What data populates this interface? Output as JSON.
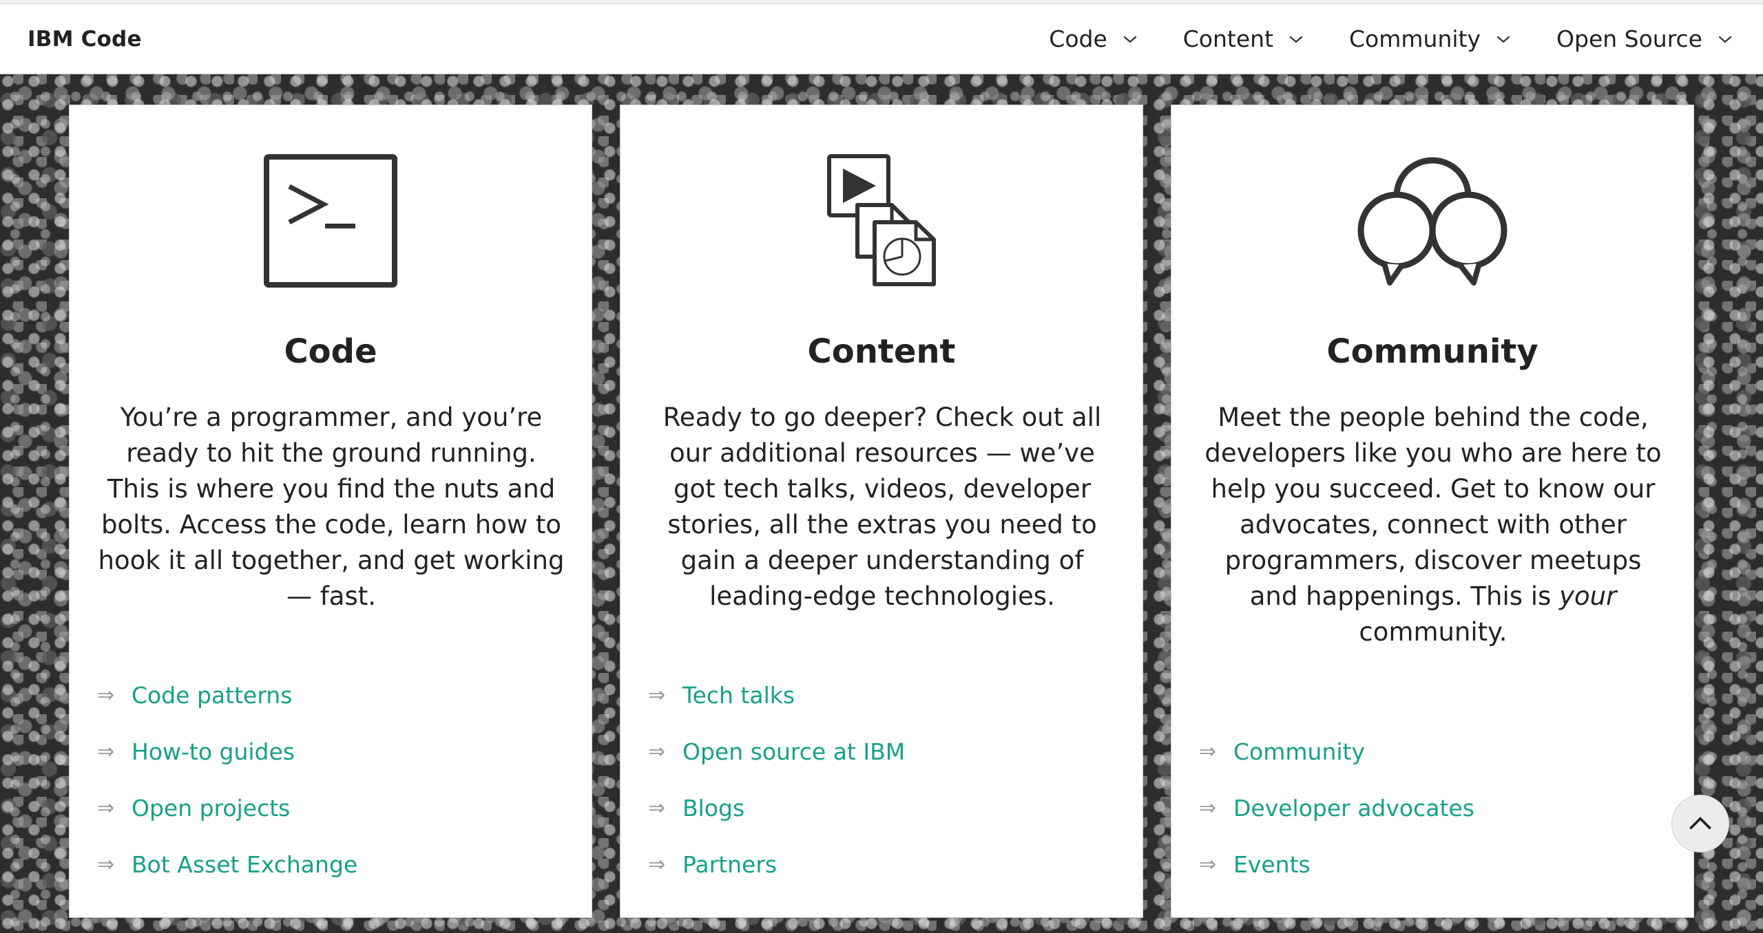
{
  "header": {
    "brand": "IBM Code",
    "nav": [
      {
        "label": "Code",
        "icon": "chevron-down-icon"
      },
      {
        "label": "Content",
        "icon": "chevron-down-icon"
      },
      {
        "label": "Community",
        "icon": "chevron-down-icon"
      },
      {
        "label": "Open Source",
        "icon": "chevron-down-icon"
      }
    ]
  },
  "cards": [
    {
      "icon": "terminal-icon",
      "title": "Code",
      "description": "You’re a programmer, and you’re ready to hit the ground running. This is where you find the nuts and bolts. Access the code, learn how to hook it all together, and get working — fast.",
      "links": [
        "Code patterns",
        "How-to guides",
        "Open projects",
        "Bot Asset Exchange"
      ]
    },
    {
      "icon": "media-documents-icon",
      "title": "Content",
      "description": "Ready to go deeper? Check out all our additional resources — we’ve got tech talks, videos, developer stories, all the extras you need to gain a deeper understanding of leading-edge technologies.",
      "links": [
        "Tech talks",
        "Open source at IBM",
        "Blogs",
        "Partners"
      ]
    },
    {
      "icon": "speech-bubbles-icon",
      "title": "Community",
      "description_before": "Meet the people behind the code, developers like you who are here to help you succeed. Get to know our advocates, connect with other programmers, discover meetups and happenings. This is ",
      "description_em": "your",
      "description_after": " community.",
      "links": [
        "Community",
        "Developer advocates",
        "Events"
      ]
    }
  ],
  "link_arrow": "⇒",
  "colors": {
    "link": "#16a088",
    "text": "#222222",
    "arrow": "#9a9a9a"
  },
  "scroll_top": {
    "icon": "chevron-up-icon"
  }
}
